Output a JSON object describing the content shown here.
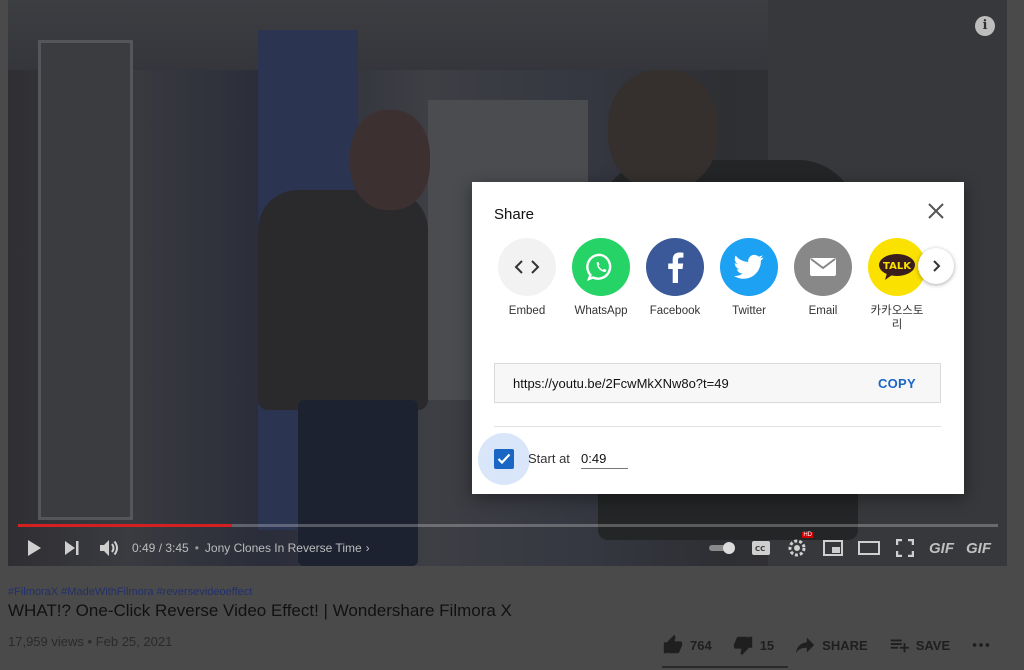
{
  "player": {
    "time": "0:49 / 3:45",
    "chapter": "Jony Clones In Reverse Time",
    "progress": 0.218,
    "gif_labels": [
      "GIF",
      "GIF"
    ]
  },
  "video_info": {
    "hashtags": "#FilmoraX #MadeWithFilmora #reversevideoeffect",
    "title": "WHAT!? One-Click Reverse Video Effect! | Wondershare Filmora X",
    "views": "17,959 views",
    "date": "Feb 25, 2021",
    "likes": "764",
    "dislikes": "15",
    "share_label": "SHARE",
    "save_label": "SAVE"
  },
  "share_dialog": {
    "title": "Share",
    "targets": [
      {
        "label": "Embed",
        "icon": "embed-icon",
        "color": "#f2f2f2"
      },
      {
        "label": "WhatsApp",
        "icon": "whatsapp-icon",
        "color": "#25d366"
      },
      {
        "label": "Facebook",
        "icon": "facebook-icon",
        "color": "#3b5998"
      },
      {
        "label": "Twitter",
        "icon": "twitter-icon",
        "color": "#1da1f2"
      },
      {
        "label": "Email",
        "icon": "email-icon",
        "color": "#888888"
      },
      {
        "label": "카카오스토리",
        "icon": "kakaotalk-icon",
        "color": "#fae100"
      }
    ],
    "kakao_badge": "TALK",
    "url": "https://youtu.be/2FcwMkXNw8o?t=49",
    "copy_label": "COPY",
    "start_at_label": "Start at",
    "start_at_value": "0:49",
    "start_at_checked": true
  }
}
